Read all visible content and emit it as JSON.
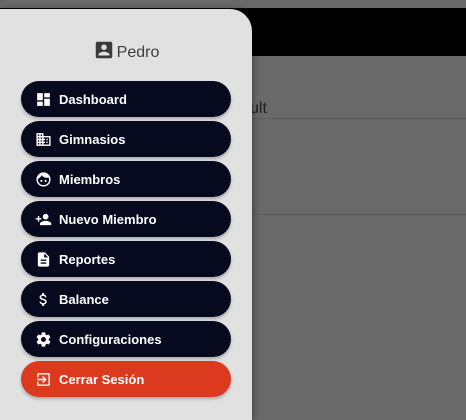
{
  "background": {
    "heading_fragment": "ult"
  },
  "drawer": {
    "user": {
      "name": "Pedro",
      "icon": "account-box-icon"
    },
    "items": [
      {
        "label": "Dashboard",
        "icon": "dashboard-icon"
      },
      {
        "label": "Gimnasios",
        "icon": "building-icon"
      },
      {
        "label": "Miembros",
        "icon": "face-icon"
      },
      {
        "label": "Nuevo Miembro",
        "icon": "person-add-icon"
      },
      {
        "label": "Reportes",
        "icon": "document-icon"
      },
      {
        "label": "Balance",
        "icon": "dollar-icon"
      },
      {
        "label": "Configuraciones",
        "icon": "settings-gear-icon"
      },
      {
        "label": "Cerrar Sesión",
        "icon": "logout-icon"
      }
    ]
  },
  "colors": {
    "nav_item_bg": "#070a1f",
    "logout_bg": "#dc3a1e",
    "drawer_bg": "#e1e1e1",
    "overlay": "#696969"
  }
}
